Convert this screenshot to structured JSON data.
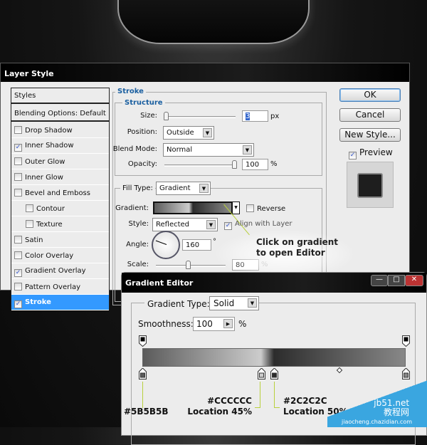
{
  "layer_style": {
    "title": "Layer Style",
    "list": [
      {
        "label": "Styles",
        "type": "header"
      },
      {
        "label": "Blending Options: Default",
        "type": "header"
      },
      {
        "label": "Drop Shadow",
        "checked": false
      },
      {
        "label": "Inner Shadow",
        "checked": true
      },
      {
        "label": "Outer Glow",
        "checked": false
      },
      {
        "label": "Inner Glow",
        "checked": false
      },
      {
        "label": "Bevel and Emboss",
        "checked": false
      },
      {
        "label": "Contour",
        "checked": false,
        "indent": true
      },
      {
        "label": "Texture",
        "checked": false,
        "indent": true
      },
      {
        "label": "Satin",
        "checked": false
      },
      {
        "label": "Color Overlay",
        "checked": false
      },
      {
        "label": "Gradient Overlay",
        "checked": true
      },
      {
        "label": "Pattern Overlay",
        "checked": false
      },
      {
        "label": "Stroke",
        "checked": true,
        "selected": true
      }
    ],
    "stroke": {
      "section": "Stroke",
      "structure": "Structure",
      "size_label": "Size:",
      "size": "3",
      "size_unit": "px",
      "size_fraction": 0.02,
      "position_label": "Position:",
      "position": "Outside",
      "blend_label": "Blend Mode:",
      "blend": "Normal",
      "opacity_label": "Opacity:",
      "opacity": "100",
      "opacity_unit": "%",
      "fill_label": "Fill Type:",
      "fill": "Gradient",
      "gradient_label": "Gradient:",
      "reverse_label": "Reverse",
      "reverse": false,
      "style_label": "Style:",
      "style": "Reflected",
      "align_label": "Align with Layer",
      "align": true,
      "angle_label": "Angle:",
      "angle": "160",
      "angle_unit": "°",
      "scale_label": "Scale:",
      "scale": "80",
      "scale_unit": "%"
    },
    "buttons": {
      "ok": "OK",
      "cancel": "Cancel",
      "new_style": "New Style...",
      "preview": "Preview"
    }
  },
  "callout": {
    "line1": "Click on gradient",
    "line2": "to open Editor"
  },
  "gradient_editor": {
    "title": "Gradient Editor",
    "type_label": "Gradient Type:",
    "type": "Solid",
    "smooth_label": "Smoothness:",
    "smooth": "100",
    "smooth_unit": "%",
    "stops": [
      {
        "location": 0,
        "color": "#5B5B5B"
      },
      {
        "location": 45,
        "color": "#CCCCCC"
      },
      {
        "location": 50,
        "color": "#2C2C2C"
      },
      {
        "location": 100,
        "color": "#888888"
      }
    ],
    "annotations": {
      "a": "#5B5B5B",
      "b1": "#CCCCCC",
      "b2": "Location 45%",
      "c1": "#2C2C2C",
      "c2": "Location 50%"
    }
  },
  "watermark": {
    "text1": "jb51.net",
    "text2": "教程网",
    "text3": "jiaocheng.chazidian.com"
  },
  "colors": {
    "accent": "#3399ff",
    "annotation": "#b8d03c",
    "heading": "#1a5fa0"
  }
}
